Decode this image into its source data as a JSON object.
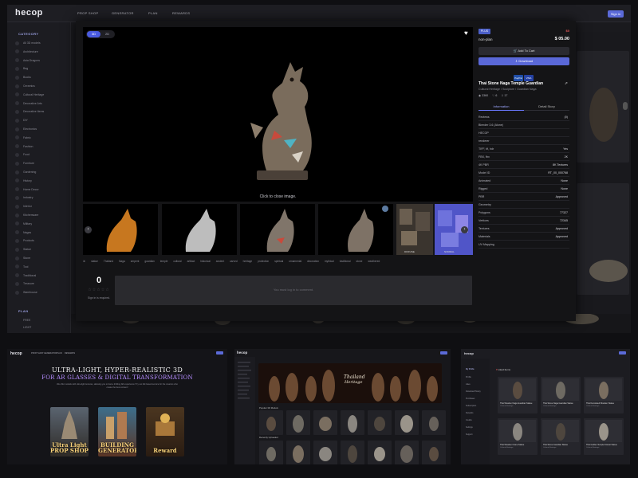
{
  "app": {
    "brand": "hecop",
    "nav": [
      "PROP SHOP",
      "GENERATOR",
      "PLAN",
      "REWARDS"
    ],
    "signin": "Sign in"
  },
  "sidebar": {
    "category_title": "CATEGORY",
    "items": [
      "All 3D models",
      "Architecture",
      "Asia Dragons",
      "Bag",
      "Books",
      "Ceramics",
      "Cultural Heritage",
      "Decorative Arts",
      "Decorative Items",
      "DIY",
      "Electronics",
      "Fabric",
      "Fashion",
      "Food",
      "Furniture",
      "Gardening",
      "History",
      "Home Decor",
      "Industry",
      "Interior",
      "Kitchenware",
      "Military",
      "Nagas",
      "Products",
      "Statue",
      "Stone",
      "Tool",
      "Traditional",
      "Treasure",
      "Warehouse"
    ],
    "plan_title": "PLAN",
    "plan_items": [
      "FREE",
      "LIGHT"
    ]
  },
  "viewer": {
    "tab_3d": "3D",
    "tab_2d": "2D",
    "fav_icon": "heart-icon",
    "close_hint": "Click to close image.",
    "thumb_captions": [
      "",
      "",
      "",
      "",
      "DIFFUSE",
      "NORMAL"
    ]
  },
  "tags": [
    "statue",
    "Thailand",
    "Naga",
    "serpent",
    "guardian",
    "temple",
    "cultural",
    "artifact",
    "historical",
    "ancient",
    "carved",
    "heritage",
    "protection",
    "spiritual",
    "ornamental",
    "decoration",
    "mythical",
    "traditional",
    "stone",
    "weathered"
  ],
  "rating": {
    "value": "0",
    "stars": "☆☆☆☆☆",
    "note": "Sign in is required."
  },
  "comment": {
    "placeholder": "You must log in to comment."
  },
  "panel": {
    "license_badge": "PLUS",
    "old_price": "$0",
    "license_name": "non-plan",
    "price": "$ 05.00",
    "add_to_cart": "Add To Cart",
    "download": "Download",
    "pay": [
      "PayPal",
      "VISA"
    ],
    "title": "Thai Stone Naga Temple Guardian",
    "breadcrumb": "Cultural Heritage / Sculpture / Guardian Naga",
    "stats": [
      "◉ 3360",
      "♡ 6",
      "⇩ 17"
    ],
    "tab_info": "Information",
    "tab_detail": "Detail Story",
    "rows": [
      {
        "k": "Reviews",
        "v": "(0)"
      },
      {
        "k": "Blender 3.6 (Alone)",
        "v": ""
      },
      {
        "k": "HECOP",
        "v": ""
      },
      {
        "k": "renderer",
        "v": ""
      },
      {
        "k": "TIFF, tif, hdr",
        "v": "Yes"
      },
      {
        "k": "FBX, fbx",
        "v": "2K"
      },
      {
        "k": "4K PBR",
        "v": "8K Textures"
      },
      {
        "k": "Model ID",
        "v": "RT_00_000768"
      },
      {
        "k": "Animated",
        "v": "None"
      },
      {
        "k": "Rigged",
        "v": "None"
      },
      {
        "k": "PBR",
        "v": "Approved"
      },
      {
        "k": "Geometry",
        "v": ""
      },
      {
        "k": "Polygons",
        "v": "77327"
      },
      {
        "k": "Vertices",
        "v": "72345"
      },
      {
        "k": "Textures",
        "v": "Approved"
      },
      {
        "k": "Materials",
        "v": "Approved"
      },
      {
        "k": "UV Mapping",
        "v": ""
      }
    ]
  },
  "shot1": {
    "brand": "hecop",
    "nav": [
      "PROP SHOP",
      "GENERATOR",
      "PLAN",
      "REWARDS"
    ],
    "hero_title": "ULTRA-LIGHT, HYPER-REALISTIC 3D",
    "hero_subtitle": "FOR AR GLASSES & DIGITAL TRANSFORMATION",
    "hero_desc": "We offer models with ultra-light textures, allowing you to feel a thrilling AR experience! Try our AR-based service for the creators who create the best content!",
    "promos": [
      "Ultra Light PROP SHOP",
      "BUILDING GENERATOR",
      "Reward"
    ]
  },
  "shot2": {
    "brand": "hecop",
    "banner_title": "Thailand",
    "banner_subtitle": "Heritage",
    "section_a": "Popular 3D Models",
    "section_b": "Recently Uploaded"
  },
  "shot3": {
    "brand": "hecop",
    "section": "My Profile",
    "liked": "Liked Items",
    "side": [
      "Profile",
      "Likes",
      "Download History",
      "Purchases",
      "Subscription",
      "Rewards",
      "Credits",
      "Settings",
      "Support"
    ],
    "cards": [
      {
        "t": "Thai Wooden Naga Guardian Statue",
        "s": "Cultural Heritage"
      },
      {
        "t": "Thai Stone Naga Guardian Statue",
        "s": "Cultural Heritage"
      },
      {
        "t": "Thai Decorated Wooden Statue",
        "s": "Cultural Heritage"
      },
      {
        "t": "Thai Wooden Crane Statue",
        "s": "Cultural Heritage"
      },
      {
        "t": "Thai Stone Guardian Statue",
        "s": "Cultural Heritage"
      },
      {
        "t": "Thai Golden Temple Kinnari Statue",
        "s": "Cultural Heritage"
      }
    ]
  }
}
